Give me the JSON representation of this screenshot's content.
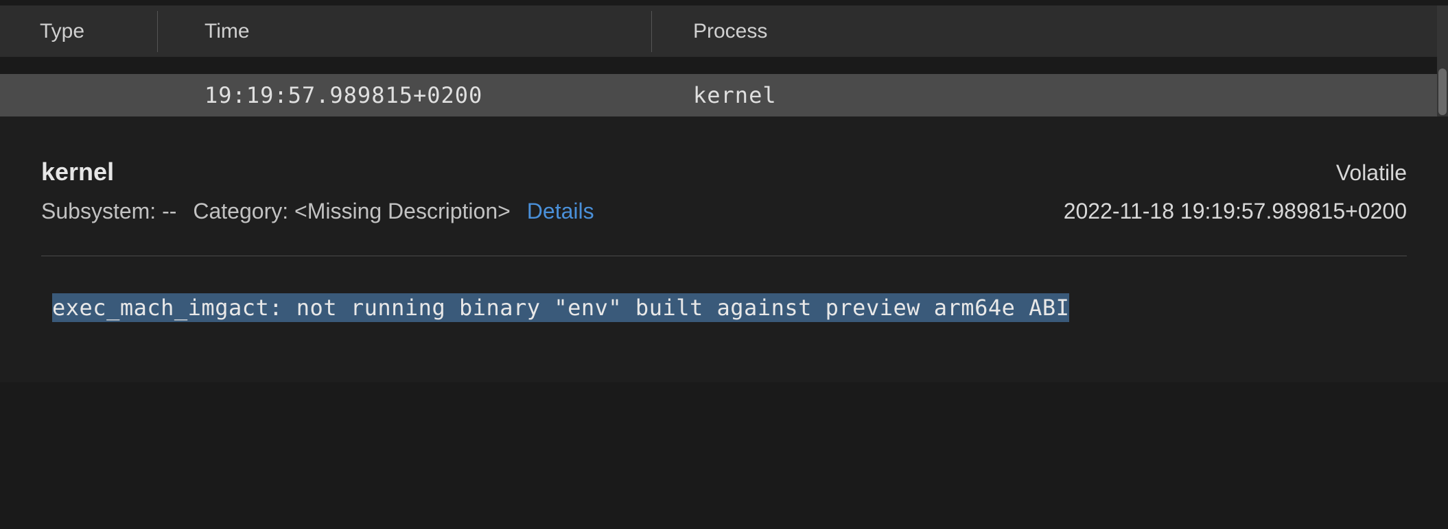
{
  "columns": {
    "type": "Type",
    "time": "Time",
    "process": "Process"
  },
  "row": {
    "type": "",
    "time": "19:19:57.989815+0200",
    "process": "kernel"
  },
  "detail": {
    "process": "kernel",
    "volatile": "Volatile",
    "subsystem_label": "Subsystem:",
    "subsystem_value": "--",
    "category_label": "Category:",
    "category_value": "<Missing Description>",
    "details_link": "Details",
    "timestamp": "2022-11-18 19:19:57.989815+0200",
    "message": "exec_mach_imgact: not running binary \"env\" built against preview arm64e ABI"
  }
}
